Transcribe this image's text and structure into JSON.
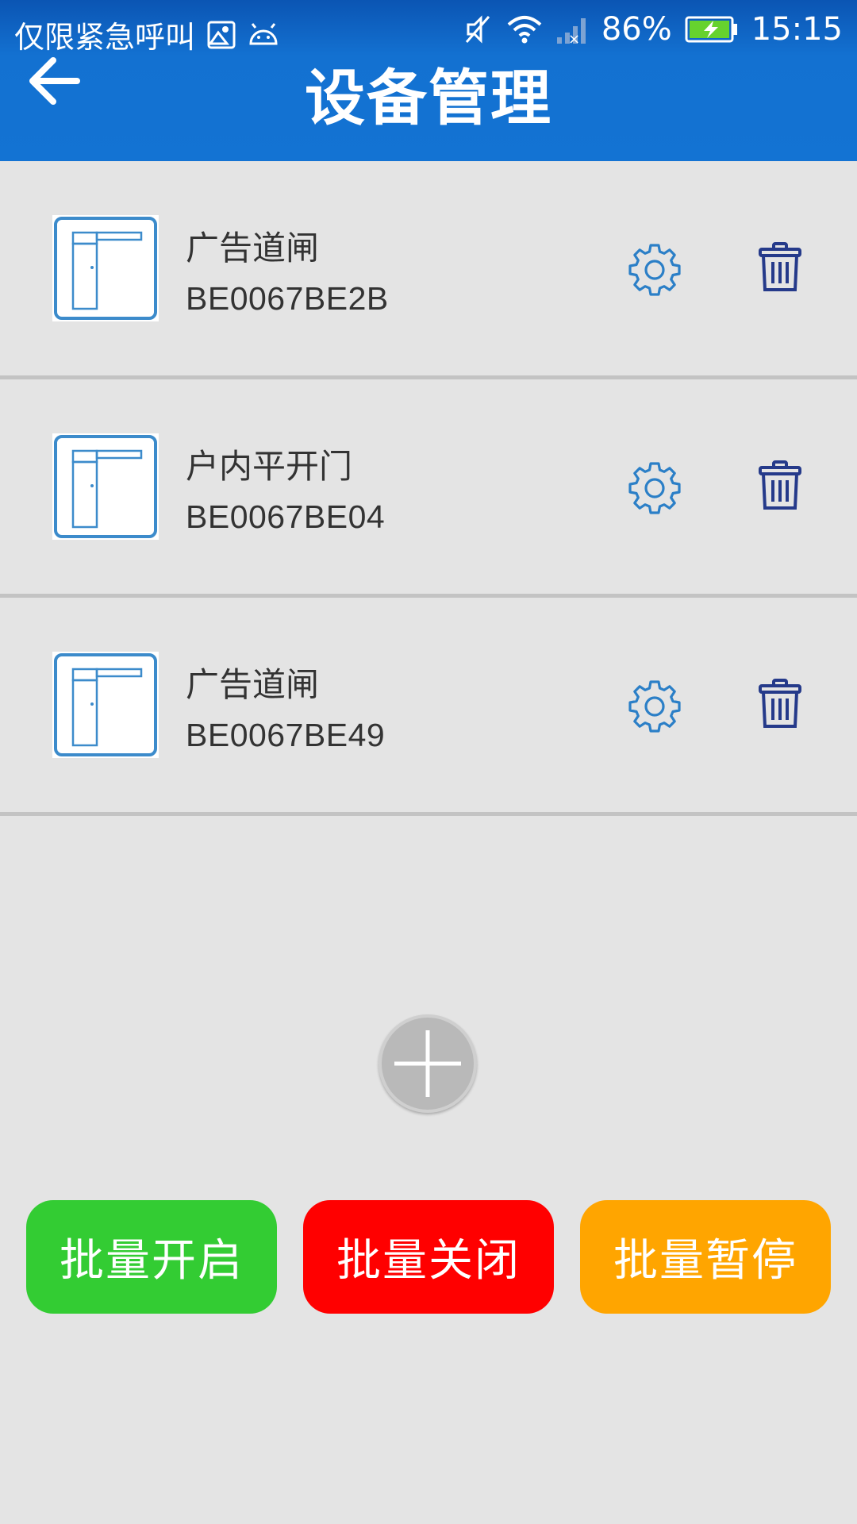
{
  "status_bar": {
    "carrier_text": "仅限紧急呼叫",
    "battery_percent": "86%",
    "time": "15:15",
    "icons": [
      "image-icon",
      "android-icon",
      "mute-icon",
      "wifi-icon",
      "signal-icon",
      "battery-charging-icon"
    ]
  },
  "header": {
    "title": "设备管理",
    "back_icon": "arrow-left-icon"
  },
  "devices": [
    {
      "name": "广告道闸",
      "id": "BE0067BE2B",
      "icon": "barrier-gate-icon"
    },
    {
      "name": "户内平开门",
      "id": "BE0067BE04",
      "icon": "barrier-gate-icon"
    },
    {
      "name": "广告道闸",
      "id": "BE0067BE49",
      "icon": "barrier-gate-icon"
    }
  ],
  "add_button_icon": "plus-icon",
  "bulk_actions": {
    "open_label": "批量开启",
    "close_label": "批量关闭",
    "pause_label": "批量暂停"
  },
  "colors": {
    "header": "#1371d1",
    "open": "#33cc33",
    "close": "#ff0000",
    "pause": "#ffa500",
    "icon_blue": "#2b7fc7",
    "trash_navy": "#253a8a"
  }
}
